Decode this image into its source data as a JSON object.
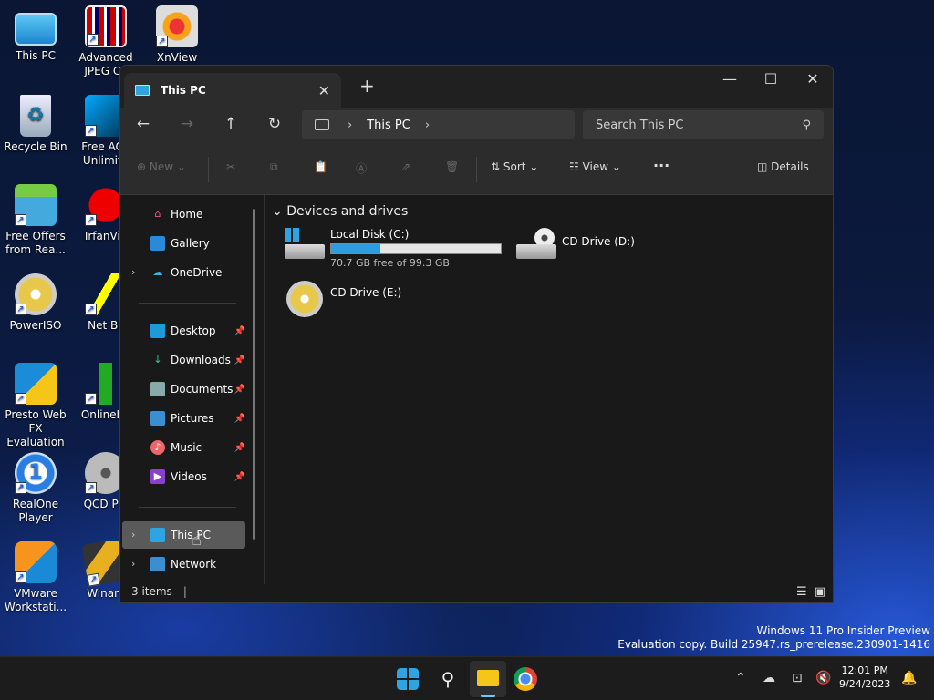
{
  "desktop": {
    "icons": [
      {
        "label": "This PC",
        "icon": "this-pc-icon"
      },
      {
        "label": "Advanced\nJPEG Co",
        "icon": "advanced-jpeg-icon"
      },
      {
        "label": "XnView",
        "icon": "xnview-icon"
      },
      {
        "label": "Recycle Bin",
        "icon": "recycle-bin-icon"
      },
      {
        "label": "Free AOL\nUnlimite",
        "icon": "aol-icon"
      },
      {
        "label": "Free Offers\nfrom Rea...",
        "icon": "gift-icon"
      },
      {
        "label": "IrfanVie",
        "icon": "irfanview-icon"
      },
      {
        "label": "PowerISO",
        "icon": "poweriso-icon"
      },
      {
        "label": "Net Bli",
        "icon": "netblitz-icon"
      },
      {
        "label": "Presto Web\nFX Evaluation",
        "icon": "presto-icon"
      },
      {
        "label": "OnlineBa",
        "icon": "onlineba-icon"
      },
      {
        "label": "RealOne\nPlayer",
        "icon": "realone-icon"
      },
      {
        "label": "QCD Pla",
        "icon": "qcd-icon"
      },
      {
        "label": "VMware\nWorkstati...",
        "icon": "vmware-icon"
      },
      {
        "label": "Winam",
        "icon": "winamp-icon"
      }
    ]
  },
  "window": {
    "tab_title": "This PC",
    "search_placeholder": "Search This PC",
    "breadcrumb": "This PC",
    "toolbar": {
      "new": "New",
      "sort": "Sort",
      "view": "View",
      "details": "Details"
    },
    "nav": {
      "home": "Home",
      "gallery": "Gallery",
      "onedrive": "OneDrive",
      "desktop": "Desktop",
      "downloads": "Downloads",
      "documents": "Documents",
      "pictures": "Pictures",
      "music": "Music",
      "videos": "Videos",
      "thispc": "This PC",
      "network": "Network"
    },
    "group_title": "Devices and drives",
    "drives": [
      {
        "name": "Local Disk (C:)",
        "free": "70.7 GB free of 99.3 GB",
        "used_fraction": 0.29
      },
      {
        "name": "CD Drive (D:)"
      },
      {
        "name": "CD Drive (E:)"
      }
    ],
    "status": "3 items"
  },
  "watermark": {
    "line1": "Windows 11 Pro Insider Preview",
    "line2": "Evaluation copy. Build 25947.rs_prerelease.230901-1416"
  },
  "clock": {
    "time": "12:01 PM",
    "date": "9/24/2023"
  },
  "colors": {
    "accent": "#2b9de0",
    "window_bg": "#191919"
  }
}
